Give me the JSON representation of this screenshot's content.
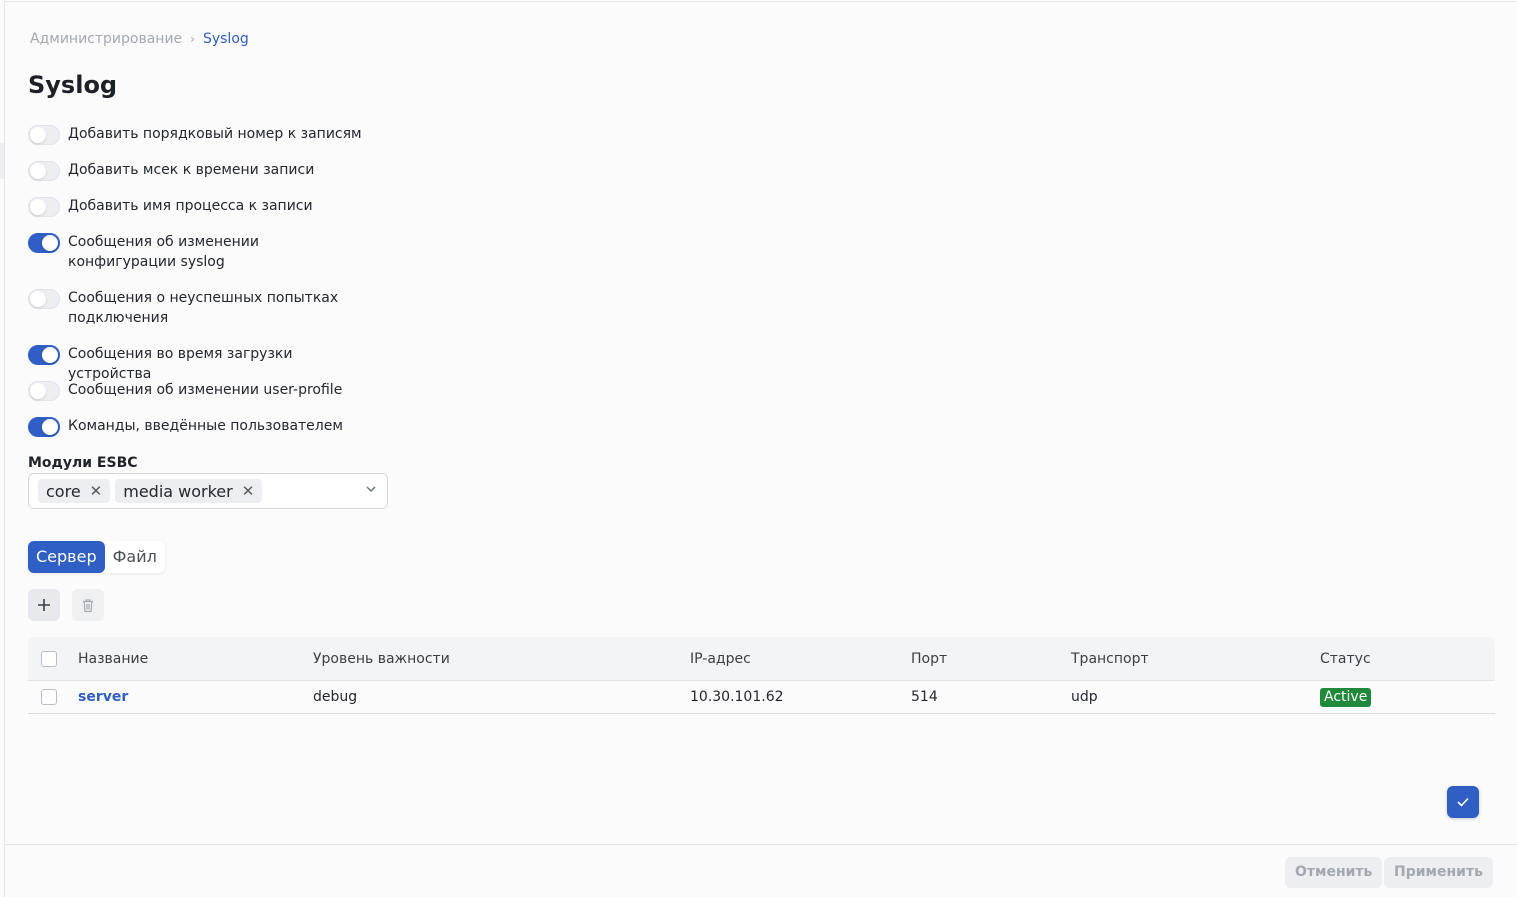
{
  "breadcrumb": {
    "parent": "Администрирование",
    "separator": "›",
    "current": "Syslog"
  },
  "page_title": "Syslog",
  "switches": [
    {
      "label": "Добавить порядковый номер к записям",
      "on": false
    },
    {
      "label": "Добавить мсек к времени записи",
      "on": false
    },
    {
      "label": "Добавить имя процесса к записи",
      "on": false
    },
    {
      "label": "Сообщения об изменении конфигурации syslog",
      "on": true
    },
    {
      "label": "Сообщения о неуспешных попытках подключения",
      "on": false
    },
    {
      "label": "Сообщения во время загрузки устройства",
      "on": true
    },
    {
      "label": "Сообщения об изменении user-profile",
      "on": false
    },
    {
      "label": "Команды, введённые пользователем",
      "on": true
    }
  ],
  "modules": {
    "label": "Модули ESBC",
    "chips": [
      "core",
      "media worker"
    ],
    "chip_remove_glyph": "✕",
    "dropdown_glyph": "⌄"
  },
  "tabs": [
    {
      "label": "Сервер",
      "active": true
    },
    {
      "label": "Файл",
      "active": false
    }
  ],
  "toolbar": {
    "add_icon": "plus-icon",
    "delete_icon": "trash-icon"
  },
  "table": {
    "headers": {
      "name": "Название",
      "level": "Уровень важности",
      "ip": "IP-адрес",
      "port": "Порт",
      "transport": "Транспорт",
      "status": "Статус"
    },
    "rows": [
      {
        "name": "server",
        "level": "debug",
        "ip": "10.30.101.62",
        "port": "514",
        "transport": "udp",
        "status": "Active"
      }
    ]
  },
  "footer": {
    "cancel_label": "Отменить",
    "apply_label": "Применить"
  },
  "colors": {
    "accent": "#2f5fc4",
    "status_active": "#1f8a3a"
  }
}
